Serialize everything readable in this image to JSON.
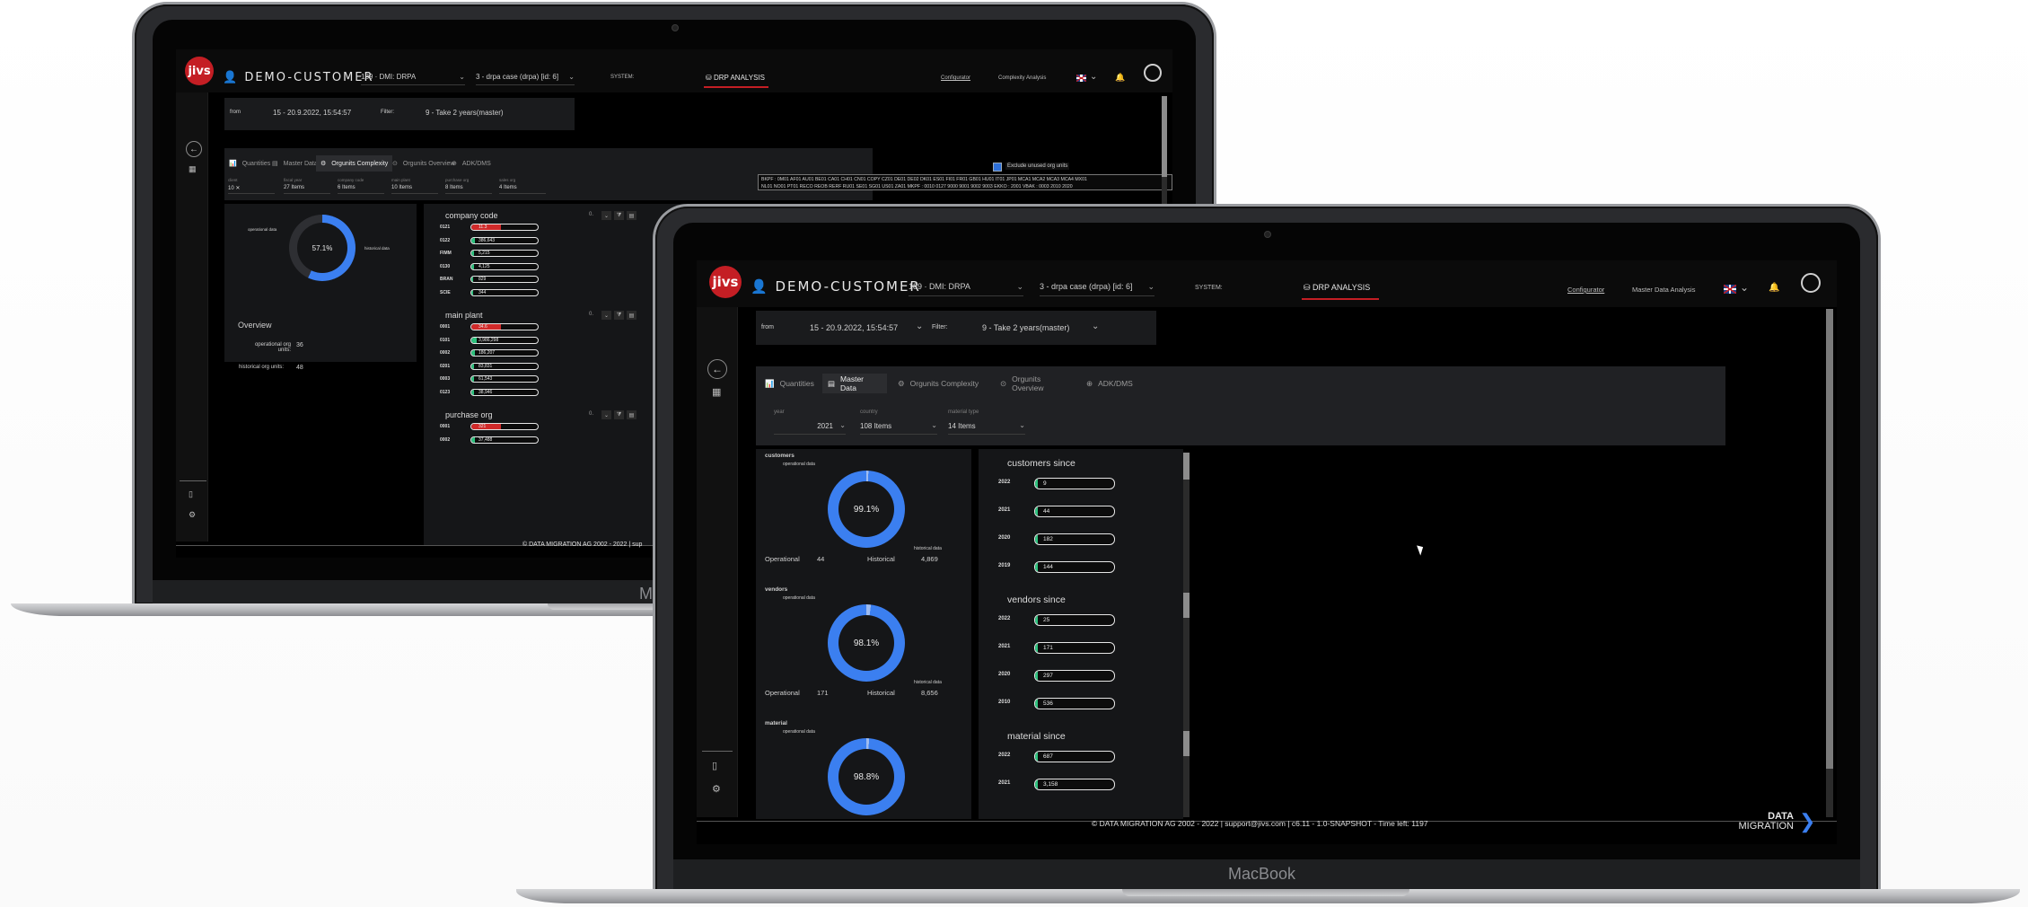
{
  "colors": {
    "accent_red": "#c41e24",
    "chart_blue": "#3b7ff0",
    "bar_green": "#2ec27e",
    "bar_red": "#d12a2a"
  },
  "app": {
    "logo_text": "jivs",
    "customer_name": "DEMO-CUSTOMER",
    "system_select": "189 · DMI: DRPA",
    "case_select": "3 - drpa case (drpa) [id: 6]",
    "system_label": "SYSTEM:",
    "drp_analysis": "DRP ANALYSIS",
    "configurator": "Configurator",
    "flag_icon": "uk-flag-icon",
    "from_label": "from",
    "date_range": "15 - 20.9.2022, 15:54:57",
    "filter_label": "Filter:",
    "filter_value": "9 - Take 2 years(master)",
    "footer_text": "© DATA MIGRATION AG 2002 - 2022 | support@jivs.com | c6.11 - 1.0-SNAPSHOT - Time left: 1197",
    "footer_short": "© DATA MIGRATION AG 2002 - 2022 | sup",
    "brand_logo_line1": "DATA",
    "brand_logo_line2": "MIGRATION",
    "macbook_label": "MacBook",
    "back_label": "M"
  },
  "back_screen": {
    "complexity_link": "Complexity Analysis",
    "tabs": [
      "Quantities",
      "Master Data",
      "Orgunits Complexity",
      "Orgunits Overview",
      "ADK/DMS"
    ],
    "active_tab": "Orgunits Complexity",
    "filters": [
      {
        "label": "client",
        "value": "10 ✕"
      },
      {
        "label": "fiscal year",
        "value": "27 Items"
      },
      {
        "label": "company code",
        "value": "6 Items"
      },
      {
        "label": "main plant",
        "value": "10 Items"
      },
      {
        "label": "purchase org",
        "value": "8 Items"
      },
      {
        "label": "sales org",
        "value": "4 Items"
      }
    ],
    "exclude_label": "Exclude unused org units",
    "tooltip_line1": "BKPF : 0M01 AF01 AU01 BE01 CA01 CH01 CN01 COPY CZ01 DE01 DE02 DK01 ES01 FI01 FR01 GB01 HU01 IT01 JP01 MCA1 MCA2 MCA3 MCA4 MX01",
    "tooltip_line2": "NL01 NO01 PT01 RECO REOB RERF RU01 SE01 SG01 US01 ZA01 MKPF : 0010 0127 9000 9001 9002 9003 EKKO : 2001 VBAK : 0003 2010 2020",
    "donut_percent": "57.1%",
    "donut_operational": "operational data",
    "donut_historical": "historical data",
    "overview_title": "Overview",
    "op_org_units_label": "operational org units:",
    "op_org_units_value": "36",
    "hist_org_units_label": "historical org units:",
    "hist_org_units_value": "48",
    "sections": [
      {
        "title": "company code",
        "counter": "0.",
        "rows": [
          {
            "label": "0121",
            "value": "11.3",
            "fill": 0.45,
            "color": "red"
          },
          {
            "label": "0122",
            "value": "386,643",
            "fill": 0.06,
            "color": "green"
          },
          {
            "label": "FIMM",
            "value": "5,215",
            "fill": 0.04,
            "color": "green"
          },
          {
            "label": "0130",
            "value": "4,125",
            "fill": 0.04,
            "color": "green"
          },
          {
            "label": "BRAN",
            "value": "829",
            "fill": 0.03,
            "color": "green"
          },
          {
            "label": "SCIE",
            "value": "344",
            "fill": 0.03,
            "color": "green"
          }
        ]
      },
      {
        "title": "main plant",
        "counter": "0.",
        "rows": [
          {
            "label": "0001",
            "value": "34.6",
            "fill": 0.45,
            "color": "red"
          },
          {
            "label": "0101",
            "value": "3,986,298",
            "fill": 0.08,
            "color": "green"
          },
          {
            "label": "0002",
            "value": "186,207",
            "fill": 0.05,
            "color": "green"
          },
          {
            "label": "0201",
            "value": "83,831",
            "fill": 0.04,
            "color": "green"
          },
          {
            "label": "0003",
            "value": "61,543",
            "fill": 0.04,
            "color": "green"
          },
          {
            "label": "0123",
            "value": "38,946",
            "fill": 0.04,
            "color": "green"
          }
        ]
      },
      {
        "title": "purchase org",
        "counter": "0.",
        "rows": [
          {
            "label": "0001",
            "value": "321",
            "fill": 0.45,
            "color": "red"
          },
          {
            "label": "0002",
            "value": "37,488",
            "fill": 0.05,
            "color": "green"
          }
        ]
      }
    ]
  },
  "front_screen": {
    "master_data_link": "Master Data Analysis",
    "tabs": [
      "Quantities",
      "Master Data",
      "Orgunits Complexity",
      "Orgunits Overview",
      "ADK/DMS"
    ],
    "active_tab": "Master Data",
    "filters": [
      {
        "label": "year",
        "value": "2021"
      },
      {
        "label": "country",
        "value": "108 Items"
      },
      {
        "label": "material type",
        "value": "14 Items"
      }
    ],
    "donuts": [
      {
        "title": "customers",
        "percent": "99.1%",
        "fraction": 0.991,
        "operational_label": "Operational",
        "operational_value": "44",
        "historical_label": "Historical",
        "historical_value": "4,869",
        "op_caption": "operational data",
        "hist_caption": "historical data"
      },
      {
        "title": "vendors",
        "percent": "98.1%",
        "fraction": 0.981,
        "operational_label": "Operational",
        "operational_value": "171",
        "historical_label": "Historical",
        "historical_value": "8,656",
        "op_caption": "operational data",
        "hist_caption": "historical data"
      },
      {
        "title": "material",
        "percent": "98.8%",
        "fraction": 0.988,
        "op_caption": "operational data"
      }
    ],
    "since_sections": [
      {
        "title": "customers since",
        "rows": [
          {
            "year": "2022",
            "value": "9",
            "fill": 0.03
          },
          {
            "year": "2021",
            "value": "44",
            "fill": 0.03
          },
          {
            "year": "2020",
            "value": "182",
            "fill": 0.03
          },
          {
            "year": "2019",
            "value": "144",
            "fill": 0.03
          }
        ]
      },
      {
        "title": "vendors since",
        "rows": [
          {
            "year": "2022",
            "value": "25",
            "fill": 0.03
          },
          {
            "year": "2021",
            "value": "171",
            "fill": 0.03
          },
          {
            "year": "2020",
            "value": "297",
            "fill": 0.03
          },
          {
            "year": "2010",
            "value": "536",
            "fill": 0.03
          }
        ]
      },
      {
        "title": "material since",
        "rows": [
          {
            "year": "2022",
            "value": "687",
            "fill": 0.03
          },
          {
            "year": "2021",
            "value": "3,158",
            "fill": 0.03
          }
        ]
      }
    ]
  }
}
